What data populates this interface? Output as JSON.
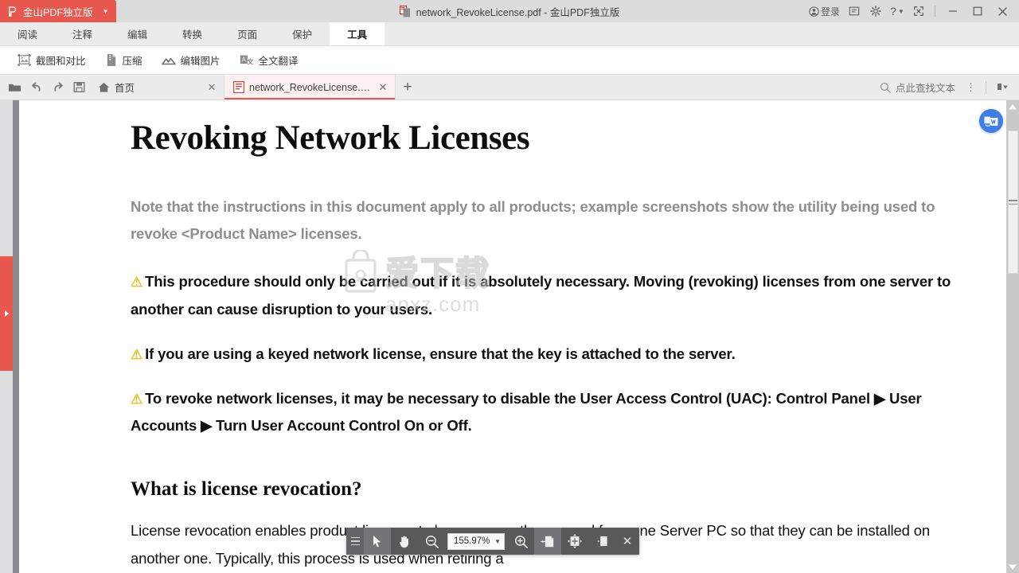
{
  "window": {
    "app_tab_label": "金山PDF独立版",
    "title": "network_RevokeLicense.pdf - 金山PDF独立版",
    "login_label": "登录",
    "controls": {
      "minimize": "—",
      "maximize": "□",
      "close": "✕",
      "help": "?"
    }
  },
  "menubar": {
    "items": [
      {
        "label": "阅读",
        "active": false
      },
      {
        "label": "注释",
        "active": false
      },
      {
        "label": "编辑",
        "active": false
      },
      {
        "label": "转换",
        "active": false
      },
      {
        "label": "页面",
        "active": false
      },
      {
        "label": "保护",
        "active": false
      },
      {
        "label": "工具",
        "active": true
      }
    ]
  },
  "ribbon": {
    "buttons": [
      {
        "label": "截图和对比",
        "icon": "screenshot-compare-icon"
      },
      {
        "label": "压缩",
        "icon": "compress-icon"
      },
      {
        "label": "编辑图片",
        "icon": "edit-image-icon"
      },
      {
        "label": "全文翻译",
        "icon": "translate-icon"
      }
    ]
  },
  "tabbar": {
    "tools": [
      "open-folder-icon",
      "undo-icon",
      "redo-icon",
      "save-icon"
    ],
    "tabs": [
      {
        "label": "首页",
        "active": false,
        "icon": "home-icon",
        "close": "✕"
      },
      {
        "label": "network_RevokeLicense.pdf",
        "active": true,
        "icon": "pdf-file-icon",
        "close": "✕"
      }
    ],
    "new_tab": "+",
    "find_placeholder": "点此查找文本",
    "kebab": "⋮"
  },
  "document": {
    "title": "Revoking Network Licenses",
    "note": "Note that the instructions in this document apply to all products; example screenshots show the utility being used to revoke <Product Name> licenses.",
    "warnings": [
      "This procedure should only be carried out if it is absolutely necessary. Moving (revoking) licenses from one server to another can cause disruption to your users.",
      "If you are using a keyed network license, ensure that the key is attached to the server.",
      "To revoke network licenses, it may be necessary to disable the User Access Control (UAC): Control Panel ▶ User Accounts ▶ Turn User Account Control On or Off."
    ],
    "heading2": "What is license revocation?",
    "body": "License revocation enables product licenses to be permanently removed from one Server PC so that they can be installed on another one. Typically, this process is used when retiring a"
  },
  "watermark": {
    "text_cn": "爱下载",
    "url": "anxz.com"
  },
  "float_toolbar": {
    "zoom_value": "155.97%",
    "buttons": [
      {
        "name": "select-tool",
        "active": true
      },
      {
        "name": "hand-tool",
        "active": false
      },
      {
        "name": "zoom-out",
        "active": false
      },
      {
        "name": "zoom-in",
        "active": false
      },
      {
        "name": "fit-width",
        "active": true
      },
      {
        "name": "fit-page",
        "active": false
      },
      {
        "name": "split-view",
        "active": false
      }
    ],
    "close": "✕"
  },
  "colors": {
    "brand_red": "#e8584f",
    "accent_blue": "#3d7eea",
    "warning_yellow": "#e8c227"
  }
}
